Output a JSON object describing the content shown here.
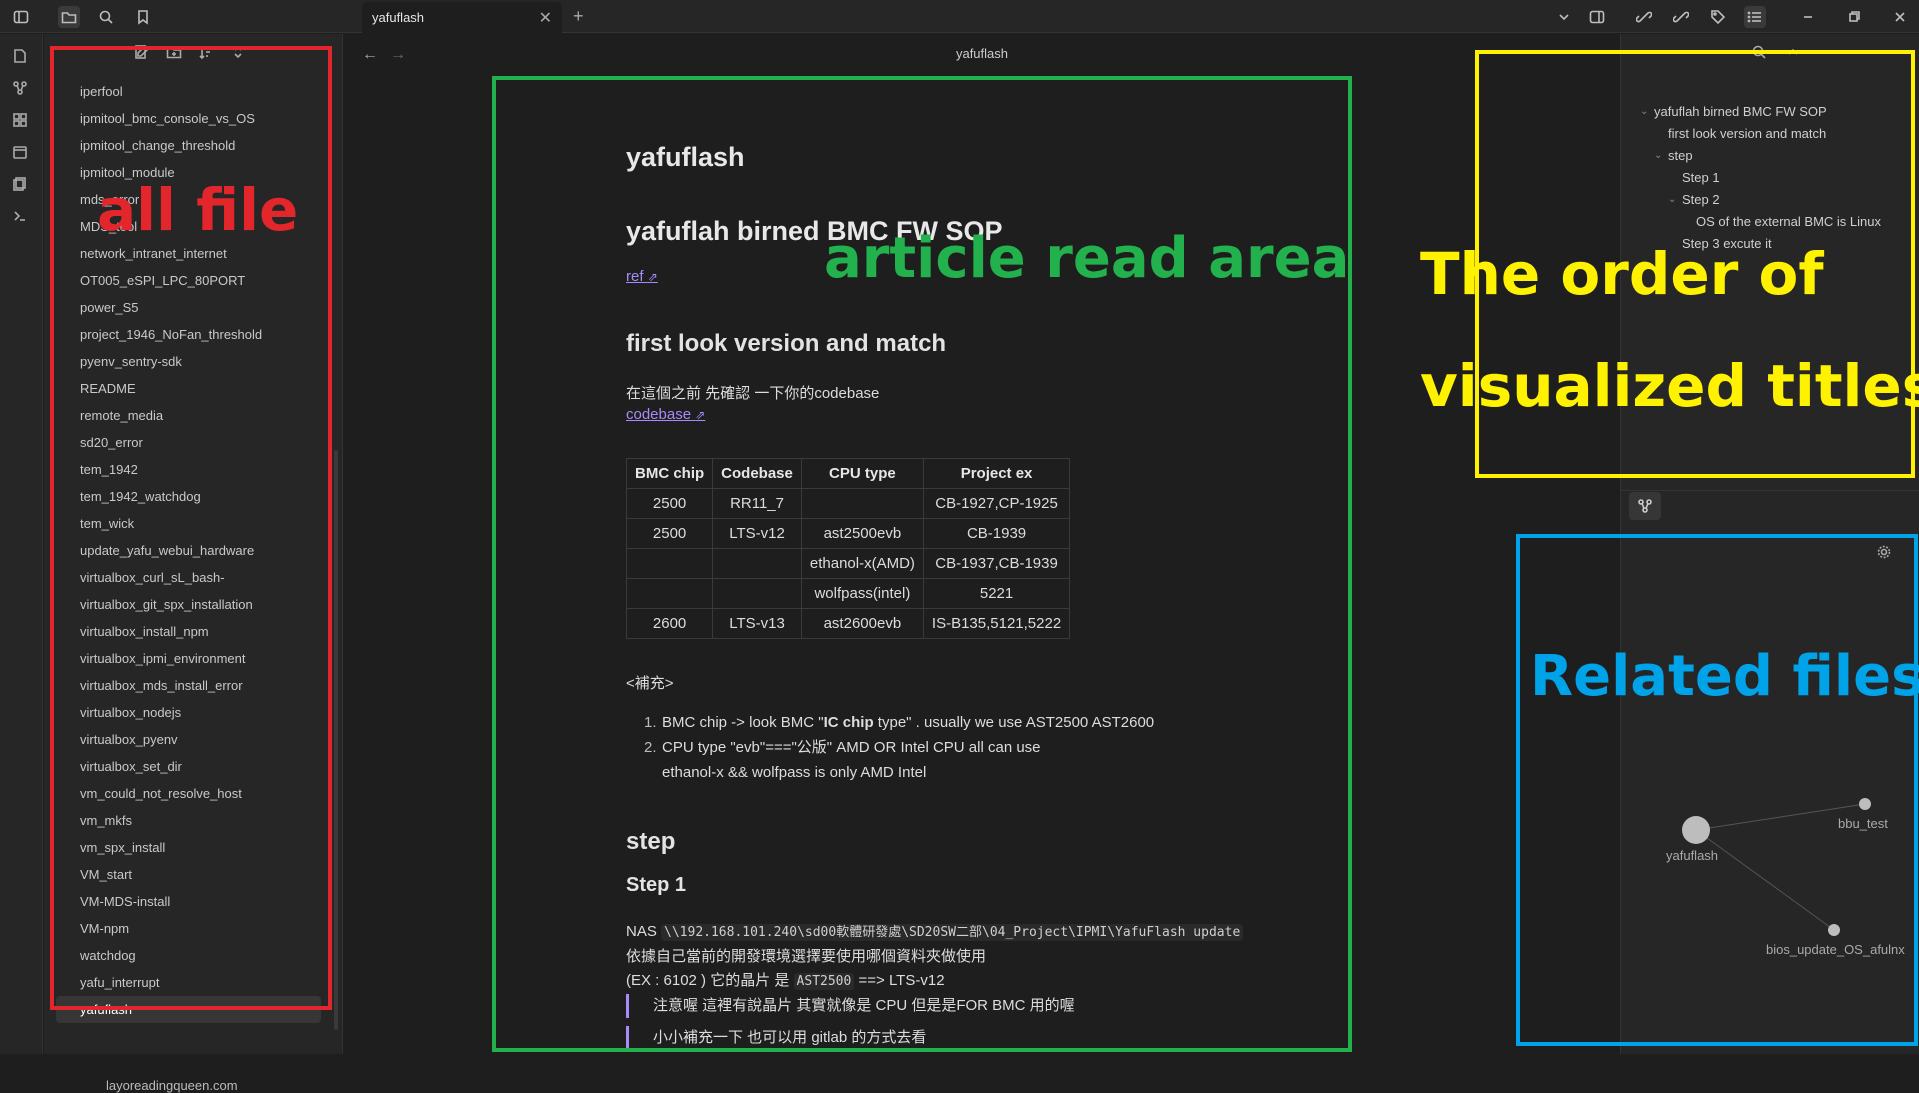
{
  "tab": {
    "title": "yafuflash",
    "close": "✕",
    "new": "+"
  },
  "explorer": {
    "files": [
      "iperfool",
      "ipmitool_bmc_console_vs_OS",
      "ipmitool_change_threshold",
      "ipmitool_module",
      "mds_error",
      "MDS_tool",
      "network_intranet_internet",
      "OT005_eSPI_LPC_80PORT",
      "power_S5",
      "project_1946_NoFan_threshold",
      "pyenv_sentry-sdk",
      "README",
      "remote_media",
      "sd20_error",
      "tem_1942",
      "tem_1942_watchdog",
      "tem_wick",
      "update_yafu_webui_hardware",
      "virtualbox_curl_sL_bash-",
      "virtualbox_git_spx_installation",
      "virtualbox_install_npm",
      "virtualbox_ipmi_environment",
      "virtualbox_mds_install_error",
      "virtualbox_nodejs",
      "virtualbox_pyenv",
      "virtualbox_set_dir",
      "vm_could_not_resolve_host",
      "vm_mkfs",
      "vm_spx_install",
      "VM_start",
      "VM-MDS-install",
      "VM-npm",
      "watchdog",
      "yafu_interrupt",
      "yafuflash"
    ],
    "active": "yafuflash",
    "vault": "layoreadingqueen.com"
  },
  "main": {
    "title_bar": "yafuflash",
    "inline_title": "yafuflash",
    "h1": "yafuflah birned BMC FW SOP",
    "ref": "ref",
    "h2a": "first look version and match",
    "p1": "在這個之前 先確認 一下你的codebase",
    "link2": "codebase",
    "table": {
      "headers": [
        "BMC chip",
        "Codebase",
        "CPU type",
        "Project ex"
      ],
      "rows": [
        [
          "2500",
          "RR11_7",
          "",
          "CB-1927,CP-1925"
        ],
        [
          "2500",
          "LTS-v12",
          "ast2500evb",
          "CB-1939"
        ],
        [
          "",
          "",
          "ethanol-x(AMD)",
          "CB-1937,CB-1939"
        ],
        [
          "",
          "",
          "wolfpass(intel)",
          "5221"
        ],
        [
          "2600",
          "LTS-v13",
          "ast2600evb",
          "IS-B135,5121,5222"
        ]
      ]
    },
    "supp": "<補充>",
    "list": {
      "item1_pre": "BMC chip -> look BMC \"",
      "item1_bold": "IC chip",
      "item1_post": " type\" . usually we use AST2500 AST2600",
      "item2_l1": "CPU type \"evb\"===\"公版\" AMD OR Intel CPU all can use",
      "item2_l2": "ethanol-x && wolfpass is only AMD Intel"
    },
    "h2b": "step",
    "h3": "Step 1",
    "nas_label": "NAS ",
    "nas_path": "\\\\192.168.101.240\\sd00軟體研發處\\SD20SW二部\\04_Project\\IPMI\\YafuFlash update",
    "nas_l2": "依據自己當前的開發環境選擇要使用哪個資料夾做使用",
    "nas_l3_pre": "(EX : 6102 ) 它的晶片 是 ",
    "nas_l3_code": "AST2500",
    "nas_l3_post": " ==> LTS-v12",
    "quote1": "注意喔 這裡有說晶片 其實就像是 CPU 但是是FOR BMC 用的喔",
    "quote2": "小小補充一下 也可以用 gitlab 的方式去看"
  },
  "outline": {
    "items": [
      {
        "label": "yafuflah birned BMC FW SOP"
      },
      {
        "label": "first look version and match"
      },
      {
        "label": "step"
      },
      {
        "label": "Step 1"
      },
      {
        "label": "Step 2"
      },
      {
        "label": "OS of the external BMC is Linux"
      },
      {
        "label": "Step 3 excute it"
      }
    ]
  },
  "graph": {
    "nodes": [
      "yafuflash",
      "bbu_test",
      "bios_update_OS_afulnx"
    ]
  },
  "annotations": {
    "all_file": "all file",
    "article": "article read area",
    "titles_l1": "The order of",
    "titles_l2": "visualized titles",
    "related": "Related files",
    "colors": {
      "red": "#e3262b",
      "green": "#22b14c",
      "yellow": "#fff200",
      "blue": "#00a2e8"
    }
  }
}
